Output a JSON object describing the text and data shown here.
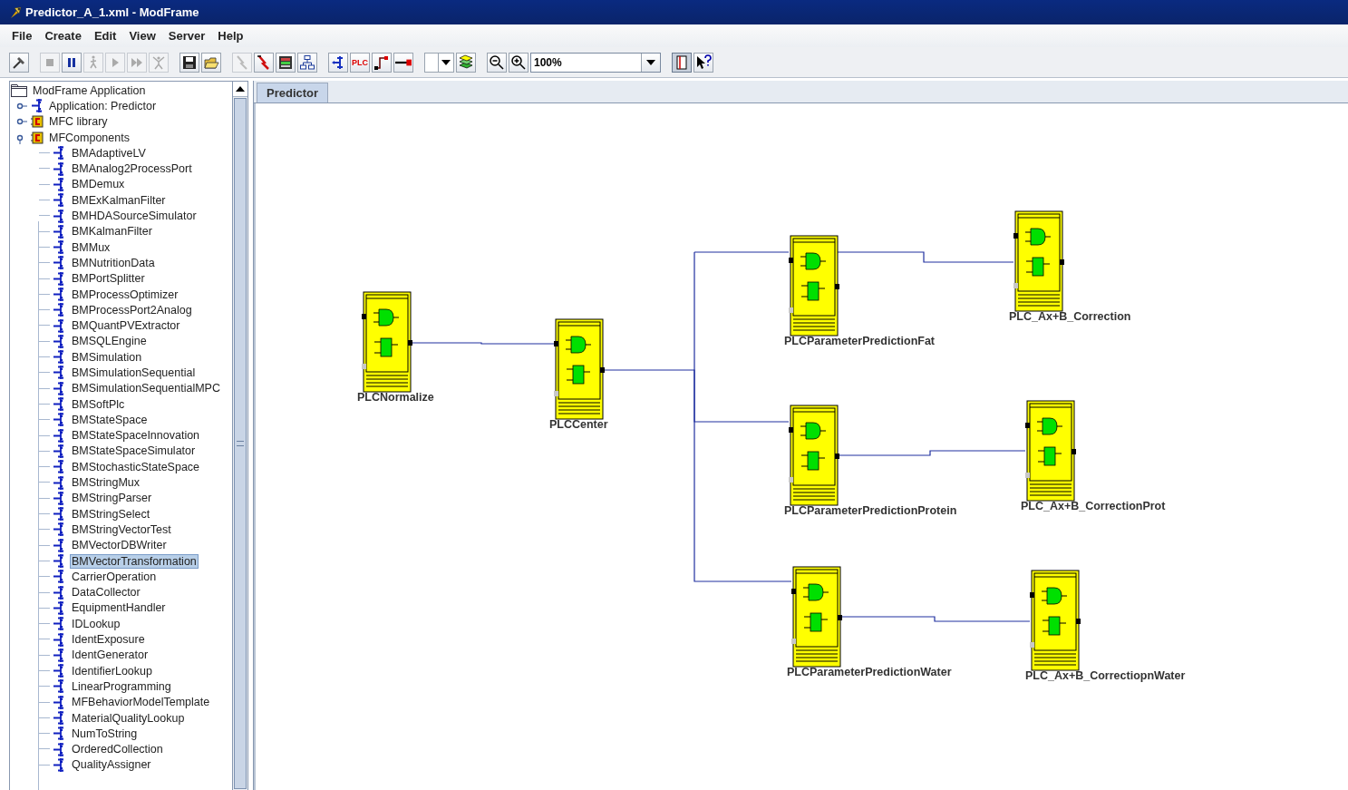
{
  "window": {
    "title": "Predictor_A_1.xml - ModFrame"
  },
  "menu": [
    "File",
    "Create",
    "Edit",
    "View",
    "Server",
    "Help"
  ],
  "toolbar": [
    {
      "kind": "hammer",
      "disabled": false
    },
    {
      "kind": "sep"
    },
    {
      "kind": "stop",
      "disabled": true
    },
    {
      "kind": "pause",
      "disabled": false
    },
    {
      "kind": "walk",
      "disabled": true
    },
    {
      "kind": "play",
      "disabled": true
    },
    {
      "kind": "ffwd",
      "disabled": true
    },
    {
      "kind": "stretch",
      "disabled": true
    },
    {
      "kind": "sep"
    },
    {
      "kind": "save",
      "disabled": false
    },
    {
      "kind": "open",
      "disabled": false
    },
    {
      "kind": "sep"
    },
    {
      "kind": "wire",
      "disabled": true
    },
    {
      "kind": "bolt",
      "disabled": false
    },
    {
      "kind": "monitor",
      "disabled": false
    },
    {
      "kind": "hierarchy",
      "disabled": false
    },
    {
      "kind": "sep"
    },
    {
      "kind": "component",
      "disabled": false
    },
    {
      "kind": "plc",
      "label": "PLC",
      "disabled": false
    },
    {
      "kind": "connector",
      "disabled": false
    },
    {
      "kind": "line",
      "disabled": false
    },
    {
      "kind": "sep"
    },
    {
      "kind": "dropdown",
      "disabled": false
    },
    {
      "kind": "layers",
      "disabled": false
    },
    {
      "kind": "sep"
    },
    {
      "kind": "zoomout",
      "disabled": false
    },
    {
      "kind": "zoomin",
      "disabled": false
    },
    {
      "kind": "zoomfield",
      "value": "100%"
    },
    {
      "kind": "sep"
    },
    {
      "kind": "book",
      "disabled": false
    },
    {
      "kind": "help",
      "disabled": false
    }
  ],
  "tree": {
    "label": "ModFrame Application",
    "children": [
      {
        "label": "Application: Predictor",
        "kind": "app",
        "expanded": false
      },
      {
        "label": "MFC library",
        "kind": "lib",
        "expanded": false
      },
      {
        "label": "MFComponents",
        "kind": "lib",
        "expanded": true,
        "children": [
          {
            "label": "BMAdaptiveLV",
            "selected": false
          },
          {
            "label": "BMAnalog2ProcessPort",
            "selected": false
          },
          {
            "label": "BMDemux",
            "selected": false
          },
          {
            "label": "BMExKalmanFilter",
            "selected": false
          },
          {
            "label": "BMHDASourceSimulator",
            "selected": false
          },
          {
            "label": "BMKalmanFilter",
            "selected": false
          },
          {
            "label": "BMMux",
            "selected": false
          },
          {
            "label": "BMNutritionData",
            "selected": false
          },
          {
            "label": "BMPortSplitter",
            "selected": false
          },
          {
            "label": "BMProcessOptimizer",
            "selected": false
          },
          {
            "label": "BMProcessPort2Analog",
            "selected": false
          },
          {
            "label": "BMQuantPVExtractor",
            "selected": false
          },
          {
            "label": "BMSQLEngine",
            "selected": false
          },
          {
            "label": "BMSimulation",
            "selected": false
          },
          {
            "label": "BMSimulationSequential",
            "selected": false
          },
          {
            "label": "BMSimulationSequentialMPC",
            "selected": false
          },
          {
            "label": "BMSoftPlc",
            "selected": false
          },
          {
            "label": "BMStateSpace",
            "selected": false
          },
          {
            "label": "BMStateSpaceInnovation",
            "selected": false
          },
          {
            "label": "BMStateSpaceSimulator",
            "selected": false
          },
          {
            "label": "BMStochasticStateSpace",
            "selected": false
          },
          {
            "label": "BMStringMux",
            "selected": false
          },
          {
            "label": "BMStringParser",
            "selected": false
          },
          {
            "label": "BMStringSelect",
            "selected": false
          },
          {
            "label": "BMStringVectorTest",
            "selected": false
          },
          {
            "label": "BMVectorDBWriter",
            "selected": false
          },
          {
            "label": "BMVectorTransformation",
            "selected": true
          },
          {
            "label": "CarrierOperation",
            "selected": false
          },
          {
            "label": "DataCollector",
            "selected": false
          },
          {
            "label": "EquipmentHandler",
            "selected": false
          },
          {
            "label": "IDLookup",
            "selected": false
          },
          {
            "label": "IdentExposure",
            "selected": false
          },
          {
            "label": "IdentGenerator",
            "selected": false
          },
          {
            "label": "IdentifierLookup",
            "selected": false
          },
          {
            "label": "LinearProgramming",
            "selected": false
          },
          {
            "label": "MFBehaviorModelTemplate",
            "selected": false
          },
          {
            "label": "MaterialQualityLookup",
            "selected": false
          },
          {
            "label": "NumToString",
            "selected": false
          },
          {
            "label": "OrderedCollection",
            "selected": false
          },
          {
            "label": "QualityAssigner",
            "selected": false
          }
        ]
      }
    ]
  },
  "tabs": [
    {
      "label": "Predictor",
      "selected": true
    }
  ],
  "diagram": {
    "blocks": [
      {
        "label": "PLCNormalize"
      },
      {
        "label": "PLCCenter"
      },
      {
        "label": "PLCParameterPredictionFat"
      },
      {
        "label": "PLC_Ax+B_Correction"
      },
      {
        "label": "PLCParameterPredictionProtein"
      },
      {
        "label": "PLC_Ax+B_CorrectionProt"
      },
      {
        "label": "PLCParameterPredictionWater"
      },
      {
        "label": "PLC_Ax+B_CorrectiopnWater"
      }
    ]
  }
}
